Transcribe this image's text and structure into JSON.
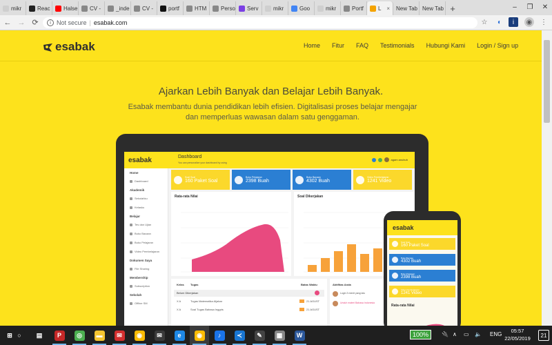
{
  "browser": {
    "tabs": [
      {
        "label": "mikr",
        "favicon_color": "#cfcfcf"
      },
      {
        "label": "Reac",
        "favicon_color": "#222222"
      },
      {
        "label": "Halse",
        "favicon_color": "#ff0000"
      },
      {
        "label": "CV -",
        "favicon_color": "#888888"
      },
      {
        "label": "_inde",
        "favicon_color": "#888888"
      },
      {
        "label": "CV -",
        "favicon_color": "#888888"
      },
      {
        "label": "portf",
        "favicon_color": "#111111"
      },
      {
        "label": "HTM",
        "favicon_color": "#888888"
      },
      {
        "label": "Perso",
        "favicon_color": "#888888"
      },
      {
        "label": "Serv",
        "favicon_color": "#7b3fe4"
      },
      {
        "label": "mikr",
        "favicon_color": "#cfcfcf"
      },
      {
        "label": "Goo",
        "favicon_color": "#4285f4"
      },
      {
        "label": "mikr",
        "favicon_color": "#cfcfcf"
      },
      {
        "label": "Portf",
        "favicon_color": "#888888"
      },
      {
        "label": "L",
        "favicon_color": "#f4a300",
        "active": true
      },
      {
        "label": "New Tab",
        "favicon_color": ""
      },
      {
        "label": "New Tab",
        "favicon_color": ""
      }
    ],
    "new_tab_label": "+",
    "window_controls": [
      "–",
      "❐",
      "✕"
    ],
    "address": {
      "security_text": "Not secure",
      "url": "esabak.com"
    }
  },
  "site": {
    "brand": "esabak",
    "nav": [
      "Home",
      "Fitur",
      "FAQ",
      "Testimonials",
      "Hubungi Kami",
      "Login / Sign up"
    ],
    "hero_title": "Ajarkan Lebih Banyak dan Belajar Lebih Banyak.",
    "hero_subtitle": "Esabak membantu dunia pendidikan lebih efisien. Digitalisasi proses belajar mengajar dan memperluas wawasan dalam satu genggaman."
  },
  "dashboard": {
    "brand": "esabak",
    "title": "Dashboard",
    "subtitle": "You can personalize your dashboard by using",
    "user": "agam anubuh",
    "sidebar": [
      {
        "type": "section",
        "label": "Home"
      },
      {
        "type": "item",
        "label": "Dashboard"
      },
      {
        "type": "section",
        "label": "Akademik"
      },
      {
        "type": "item",
        "label": "Sekolahku"
      },
      {
        "type": "item",
        "label": "Kelasku"
      },
      {
        "type": "section",
        "label": "Belajar"
      },
      {
        "type": "item",
        "label": "Tes dan Ujian"
      },
      {
        "type": "item",
        "label": "Buku Bacaan"
      },
      {
        "type": "item",
        "label": "Buku Pelajaran"
      },
      {
        "type": "item",
        "label": "Video Pembelajaran"
      },
      {
        "type": "section",
        "label": "Dokumen Saya"
      },
      {
        "type": "item",
        "label": "File Sharing"
      },
      {
        "type": "section",
        "label": "Membership"
      },
      {
        "type": "item",
        "label": "Subscription"
      },
      {
        "type": "section",
        "label": "Sekolah"
      },
      {
        "type": "item",
        "label": "Offline SM"
      }
    ],
    "cards": [
      {
        "label": "Soal Soal",
        "value": "160 Paket Soal",
        "color": "#fbd82b"
      },
      {
        "label": "Buku Pelajaran",
        "value": "2398 Buah",
        "color": "#2b7fd3"
      },
      {
        "label": "Buku Bacaan",
        "value": "4302 Buah",
        "color": "#2b7fd3"
      },
      {
        "label": "Video Pembelajaran",
        "value": "1241 Video",
        "color": "#fbd82b"
      }
    ],
    "panel_left_title": "Rata-rata Nilai",
    "panel_right_title": "Soal Dikerjakan",
    "table": {
      "headers": [
        "Kelas",
        "Tugas",
        "Batas Waktu"
      ],
      "group": "Belum Dikerjakan",
      "rows": [
        {
          "kelas": "X A",
          "tugas": "Tugas Matematika Aljabar",
          "date": "21 AGUST"
        },
        {
          "kelas": "X A",
          "tugas": "Soal Tugas Bahasa Inggris",
          "date": "21 AGUST"
        }
      ]
    },
    "activity": {
      "title": "Aktifitas Anda",
      "items": [
        "Login 3 menit yang lalu",
        "Unduh materi Bahasa Indonesia"
      ]
    }
  },
  "phone": {
    "brand": "esabak",
    "cards": [
      {
        "label": "Soal Soal",
        "value": "160 Paket Soal",
        "color": "#fbd82b"
      },
      {
        "label": "Buku Bacaan",
        "value": "4302 Buah",
        "color": "#2b7fd3"
      },
      {
        "label": "Buku Pelajaran",
        "value": "2398 Buah",
        "color": "#2b7fd3"
      },
      {
        "label": "Video Pembelajaran",
        "value": "1241 Video",
        "color": "#fbd82b"
      }
    ],
    "chart_title": "Rata-rata Nilai"
  },
  "taskbar": {
    "apps": [
      "start",
      "search",
      "task-view",
      "pdf",
      "chrome-alt",
      "files",
      "mail-red",
      "chrome",
      "mail",
      "edge",
      "chrome-active",
      "music",
      "vscode",
      "photos",
      "notes",
      "word"
    ],
    "battery": "100%",
    "lang": "ENG",
    "time": "05:57",
    "date": "22/05/2019",
    "notifications": "21"
  }
}
